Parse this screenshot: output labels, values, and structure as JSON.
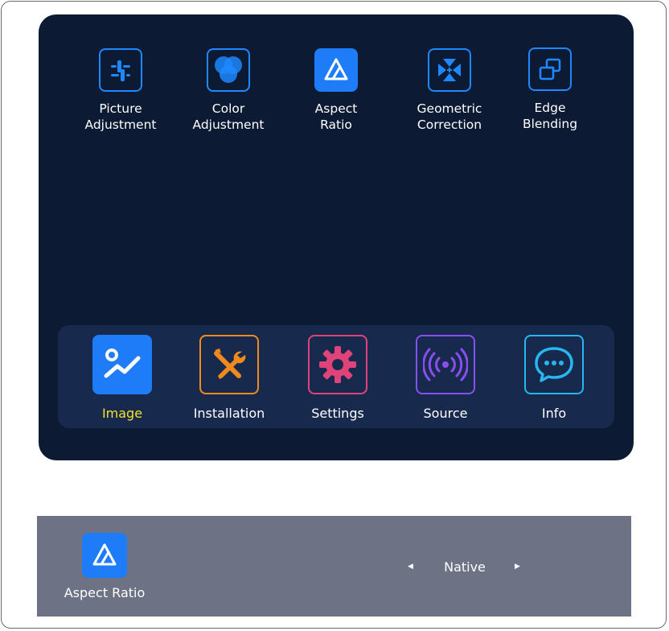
{
  "submenu": {
    "items": [
      {
        "label": "Picture\nAdjustment",
        "icon": "sliders-icon",
        "selected": false
      },
      {
        "label": "Color\nAdjustment",
        "icon": "color-circles-icon",
        "selected": false
      },
      {
        "label": "Aspect\nRatio",
        "icon": "aspect-ratio-icon",
        "selected": true
      },
      {
        "label": "Geometric\nCorrection",
        "icon": "geometric-correction-icon",
        "selected": false
      },
      {
        "label": "Edge\nBlending",
        "icon": "edge-blending-icon",
        "selected": false
      }
    ]
  },
  "tabs": {
    "items": [
      {
        "label": "Image",
        "icon": "image-icon",
        "active": true,
        "color": "#1e7cf8"
      },
      {
        "label": "Installation",
        "icon": "tools-icon",
        "active": false,
        "color": "#f08a1c"
      },
      {
        "label": "Settings",
        "icon": "gear-icon",
        "active": false,
        "color": "#e0437a"
      },
      {
        "label": "Source",
        "icon": "signal-icon",
        "active": false,
        "color": "#8a4ef0"
      },
      {
        "label": "Info",
        "icon": "chat-bubble-icon",
        "active": false,
        "color": "#27b6ef"
      }
    ]
  },
  "status": {
    "label": "Aspect Ratio",
    "icon": "aspect-ratio-icon",
    "value": "Native",
    "left_arrow": "◀",
    "right_arrow": "▶"
  },
  "colors": {
    "osd_background": "#0c1a33",
    "tabbar_background": "#172a4d",
    "accent_blue": "#1e7cf8",
    "active_label": "#f2e02a",
    "status_bar": "#6d7385"
  }
}
